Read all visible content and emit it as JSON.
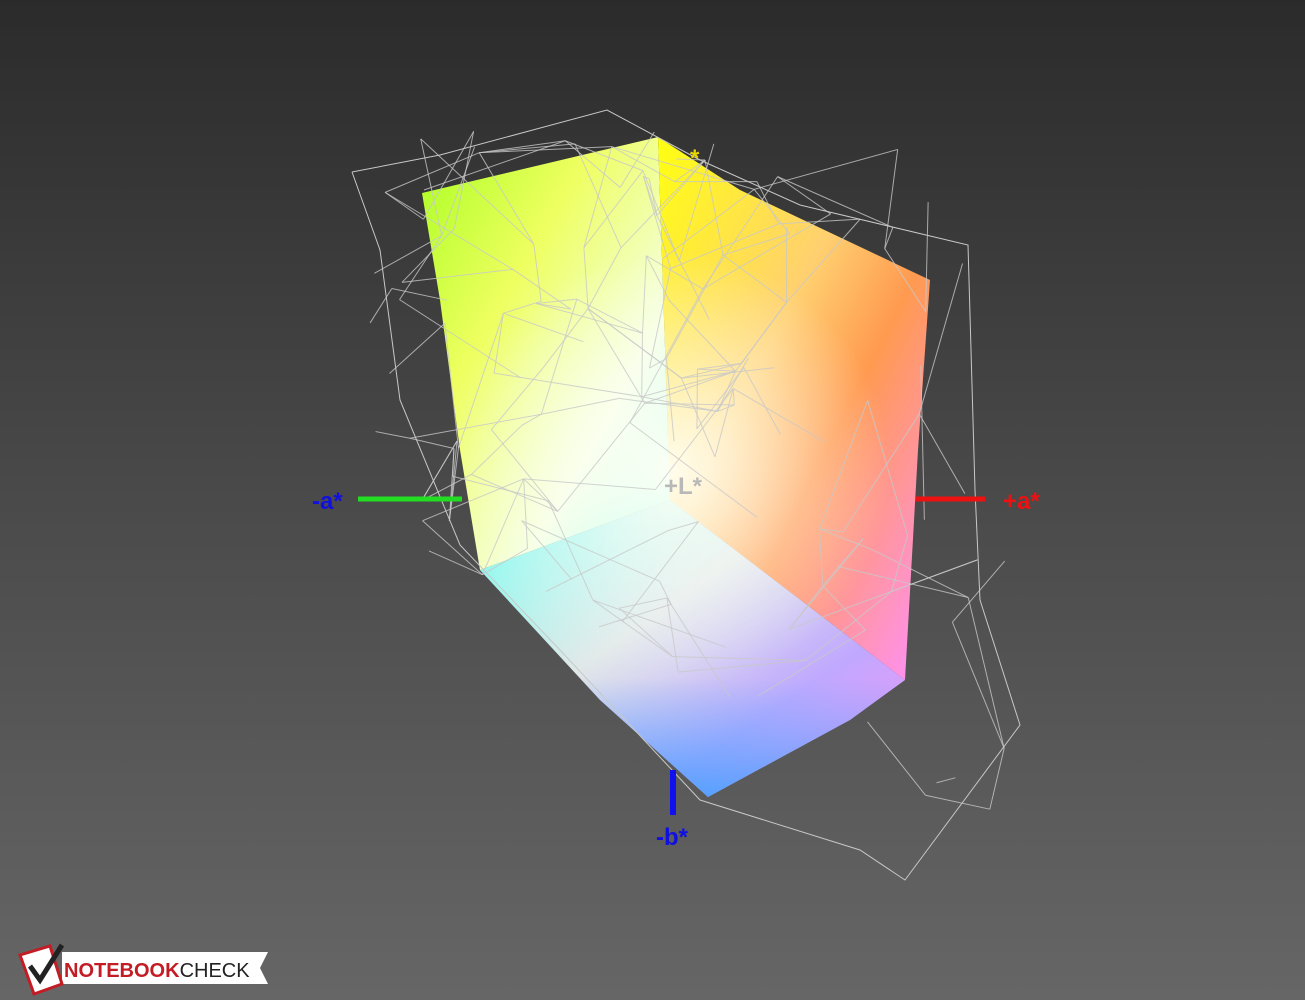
{
  "axes": {
    "neg_a": {
      "label": "-a*",
      "label_color": "#1010e0",
      "line_color": "#22dd22"
    },
    "pos_a": {
      "label": "+a*",
      "label_color": "#ee1111",
      "line_color": "#ee1111"
    },
    "neg_b": {
      "label": "-b*",
      "label_color": "#1010e0",
      "line_color": "#1010ee"
    },
    "pos_b": {
      "label": "*",
      "label_color": "#e8d800"
    },
    "pos_l": {
      "label": "+L*",
      "label_color": "#b8b8b8"
    }
  },
  "logo": {
    "part1": "NOTEBOOK",
    "part2": "CHECK",
    "part1_color": "#c41c24",
    "part2_color": "#222222"
  }
}
